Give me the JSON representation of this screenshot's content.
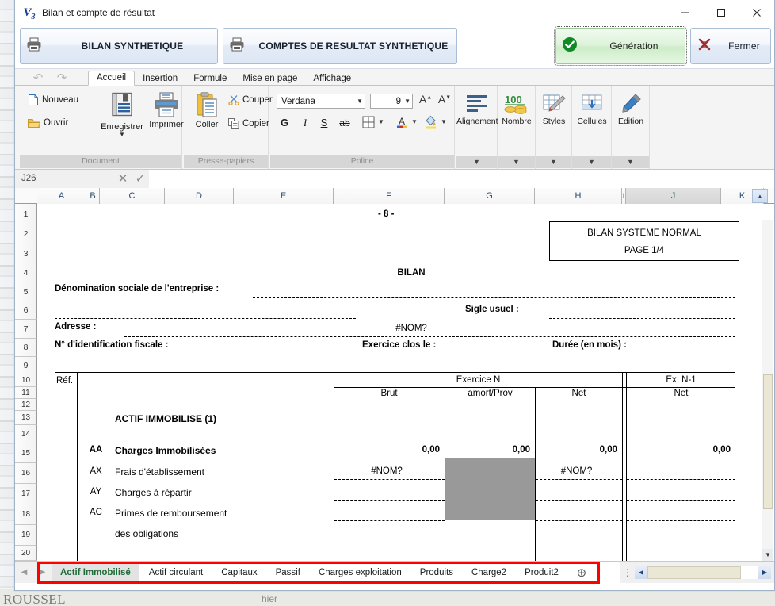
{
  "window": {
    "title": "Bilan et compte de résultat",
    "logo": "V3",
    "minimize_icon": "minimize-icon",
    "maximize_icon": "maximize-icon",
    "close_icon": "close-icon"
  },
  "actionbar": {
    "bilan_label": "BILAN SYNTHETIQUE",
    "comptes_label": "COMPTES DE RESULTAT SYNTHETIQUE",
    "generation_label": "Génération",
    "fermer_label": "Fermer"
  },
  "ribbon": {
    "tabs": [
      {
        "label": "Accueil",
        "active": true
      },
      {
        "label": "Insertion",
        "active": false
      },
      {
        "label": "Formule",
        "active": false
      },
      {
        "label": "Mise en page",
        "active": false
      },
      {
        "label": "Affichage",
        "active": false
      }
    ],
    "groups": [
      {
        "name": "Document"
      },
      {
        "name": "Presse-papiers"
      },
      {
        "name": "Police"
      }
    ],
    "document": {
      "nouveau": "Nouveau",
      "ouvrir": "Ouvrir",
      "enregistrer": "Enregistrer",
      "imprimer": "Imprimer"
    },
    "clipboard": {
      "coller": "Coller",
      "couper": "Couper",
      "copier": "Copier"
    },
    "police": {
      "font_name": "Verdana",
      "font_size": "9",
      "grow_font": "A",
      "shrink_font": "A",
      "bold": "G",
      "italic": "I",
      "underline": "S",
      "strike": "ab"
    },
    "right_groups": [
      {
        "label": "Alignement"
      },
      {
        "label": "Nombre"
      },
      {
        "label": "Styles"
      },
      {
        "label": "Cellules"
      },
      {
        "label": "Edition"
      }
    ]
  },
  "formulabar": {
    "namebox": "J26",
    "cancel_icon": "cancel-icon",
    "accept_icon": "accept-icon",
    "formula_value": ""
  },
  "grid": {
    "columns": [
      "A",
      "B",
      "C",
      "D",
      "E",
      "F",
      "G",
      "H",
      "I",
      "J",
      "K"
    ],
    "selected_column": "J",
    "rows": [
      "1",
      "2",
      "3",
      "4",
      "5",
      "6",
      "7",
      "8",
      "9",
      "10",
      "11",
      "12",
      "13",
      "14",
      "15",
      "16",
      "17",
      "18",
      "19",
      "20"
    ],
    "cells": {
      "page_number": "- 8 -",
      "box_line1": "BILAN SYSTEME NORMAL",
      "box_line2": "PAGE 1/4",
      "bilan_title": "BILAN",
      "denomination": "Dénomination sociale de l'entreprise :",
      "sigle": "Sigle usuel :",
      "adresse": "Adresse :",
      "nom_error": "#NOM?",
      "nif": "N° d'identification fiscale :",
      "exercice_clos": "Exercice clos le :",
      "duree": "Durée (en mois) :",
      "ref": "Réf.",
      "exercice_n": "Exercice N",
      "ex_n1": "Ex. N-1",
      "brut": "Brut",
      "amort_prov": "amort/Prov",
      "net": "Net",
      "net2": "Net",
      "actif_immobilise": "ACTIF IMMOBILISE (1)",
      "aa_code": "AA",
      "aa_label": "Charges Immobilisées",
      "ax_code": "AX",
      "ax_label": "Frais d'établissement",
      "ay_code": "AY",
      "ay_label": "Charges à répartir",
      "ac_code": "AC",
      "ac_label": "Primes de  remboursement",
      "ac_label2": "des obligations",
      "aa_brut": "0,00",
      "aa_amort": "0,00",
      "aa_net": "0,00",
      "aa_netn1": "0,00",
      "ax_brut": "#NOM?",
      "ax_net": "#NOM?"
    }
  },
  "sheettabs": {
    "prev_icon": "prev-sheet-icon",
    "next_icon": "next-sheet-icon",
    "add_icon": "add-sheet-icon",
    "menu_icon": "sheet-menu-icon",
    "tabs": [
      {
        "label": "Actif  Immobilisé",
        "active": true
      },
      {
        "label": "Actif circulant",
        "active": false
      },
      {
        "label": "Capitaux",
        "active": false
      },
      {
        "label": "Passif",
        "active": false
      },
      {
        "label": "Charges exploitation",
        "active": false
      },
      {
        "label": "Produits",
        "active": false
      },
      {
        "label": "Charge2",
        "active": false
      },
      {
        "label": "Produit2",
        "active": false
      }
    ]
  },
  "background": {
    "bottom_label": "ROUSSEL",
    "bottom_label2": "hier"
  },
  "colors": {
    "accent_blue": "#2b4a6f",
    "generation_green": "#1f8a34",
    "close_red": "#b03030",
    "highlight_red": "#ff0000",
    "selected_tab_green": "#1f6b3a"
  }
}
